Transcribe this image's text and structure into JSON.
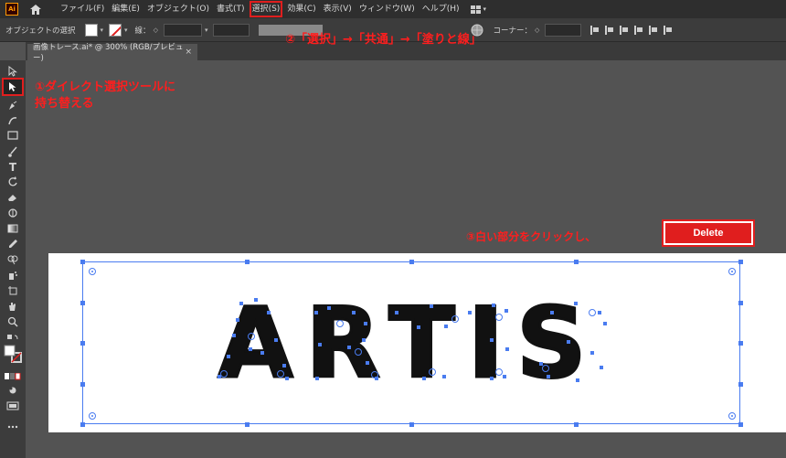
{
  "app": {
    "logo_text": "Ai"
  },
  "menu": {
    "items": [
      {
        "label": "ファイル(F)"
      },
      {
        "label": "編集(E)"
      },
      {
        "label": "オブジェクト(O)"
      },
      {
        "label": "書式(T)"
      },
      {
        "label": "選択(S)"
      },
      {
        "label": "効果(C)"
      },
      {
        "label": "表示(V)"
      },
      {
        "label": "ウィンドウ(W)"
      },
      {
        "label": "ヘルプ(H)"
      }
    ]
  },
  "control_bar": {
    "object_state": "オブジェクトの選択",
    "stroke_label": "線：",
    "corner_label": "コーナー："
  },
  "document_tab": {
    "title": "画像トレース.ai* @ 300% (RGB/プレビュー)",
    "close": "×"
  },
  "annotations": {
    "step1_line1": "①ダイレクト選択ツールに",
    "step1_line2": "持ち替える",
    "step2": "②「選択」→「共通」→「塗りと線」",
    "step3": "③白い部分をクリックし、",
    "delete_label": "Delete"
  },
  "artwork": {
    "text": "ARTIS"
  },
  "colors": {
    "annotation_red": "#e01e1e",
    "selection_blue": "#4a7cf0",
    "canvas_gray": "#535353",
    "artboard_white": "#ffffff"
  },
  "icons": {
    "toolbar": [
      "selection-tool-icon",
      "direct-selection-tool-icon",
      "pen-tool-icon",
      "curvature-tool-icon",
      "rectangle-tool-icon",
      "paintbrush-tool-icon",
      "type-tool-icon",
      "rotate-tool-icon",
      "eraser-tool-icon",
      "warp-tool-icon",
      "gradient-tool-icon",
      "eyedropper-tool-icon",
      "shape-builder-tool-icon",
      "symbol-sprayer-tool-icon",
      "artboard-tool-icon",
      "hand-tool-icon",
      "zoom-tool-icon",
      "fill-stroke-icon",
      "draw-mode-icon",
      "screen-mode-icon",
      "more-tools-icon"
    ]
  }
}
